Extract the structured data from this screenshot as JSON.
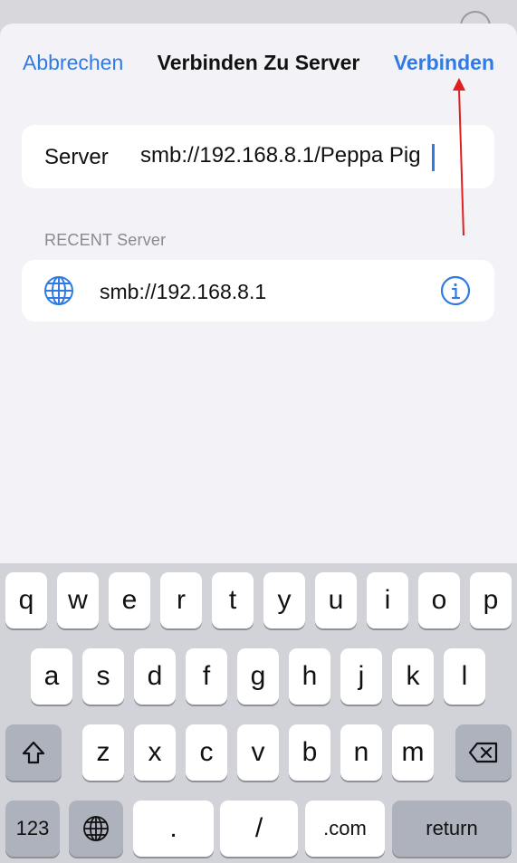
{
  "nav": {
    "cancel_label": "Abbrechen",
    "title": "Verbinden Zu Server",
    "connect_label": "Verbinden"
  },
  "server": {
    "label": "Server",
    "value": "smb://192.168.8.1/Peppa Pig"
  },
  "recent": {
    "section_label": "RECENT Server",
    "items": [
      {
        "icon": "globe-icon",
        "address": "smb://192.168.8.1",
        "action_icon": "info-icon"
      }
    ]
  },
  "keyboard": {
    "row1": [
      "q",
      "w",
      "e",
      "r",
      "t",
      "y",
      "u",
      "i",
      "o",
      "p"
    ],
    "row2": [
      "a",
      "s",
      "d",
      "f",
      "g",
      "h",
      "j",
      "k",
      "l"
    ],
    "row3": [
      "z",
      "x",
      "c",
      "v",
      "b",
      "n",
      "m"
    ],
    "shift_icon": "shift-icon",
    "backspace_icon": "backspace-icon",
    "numbers_label": "123",
    "globe_icon": "globe-icon",
    "dot_label": ".",
    "slash_label": "/",
    "dotcom_label": ".com",
    "return_label": "return"
  },
  "colors": {
    "accent": "#2f7ae5",
    "annotation_arrow": "#e02020",
    "sheet_background": "#f2f2f7",
    "keyboard_background": "#d1d3d9"
  }
}
